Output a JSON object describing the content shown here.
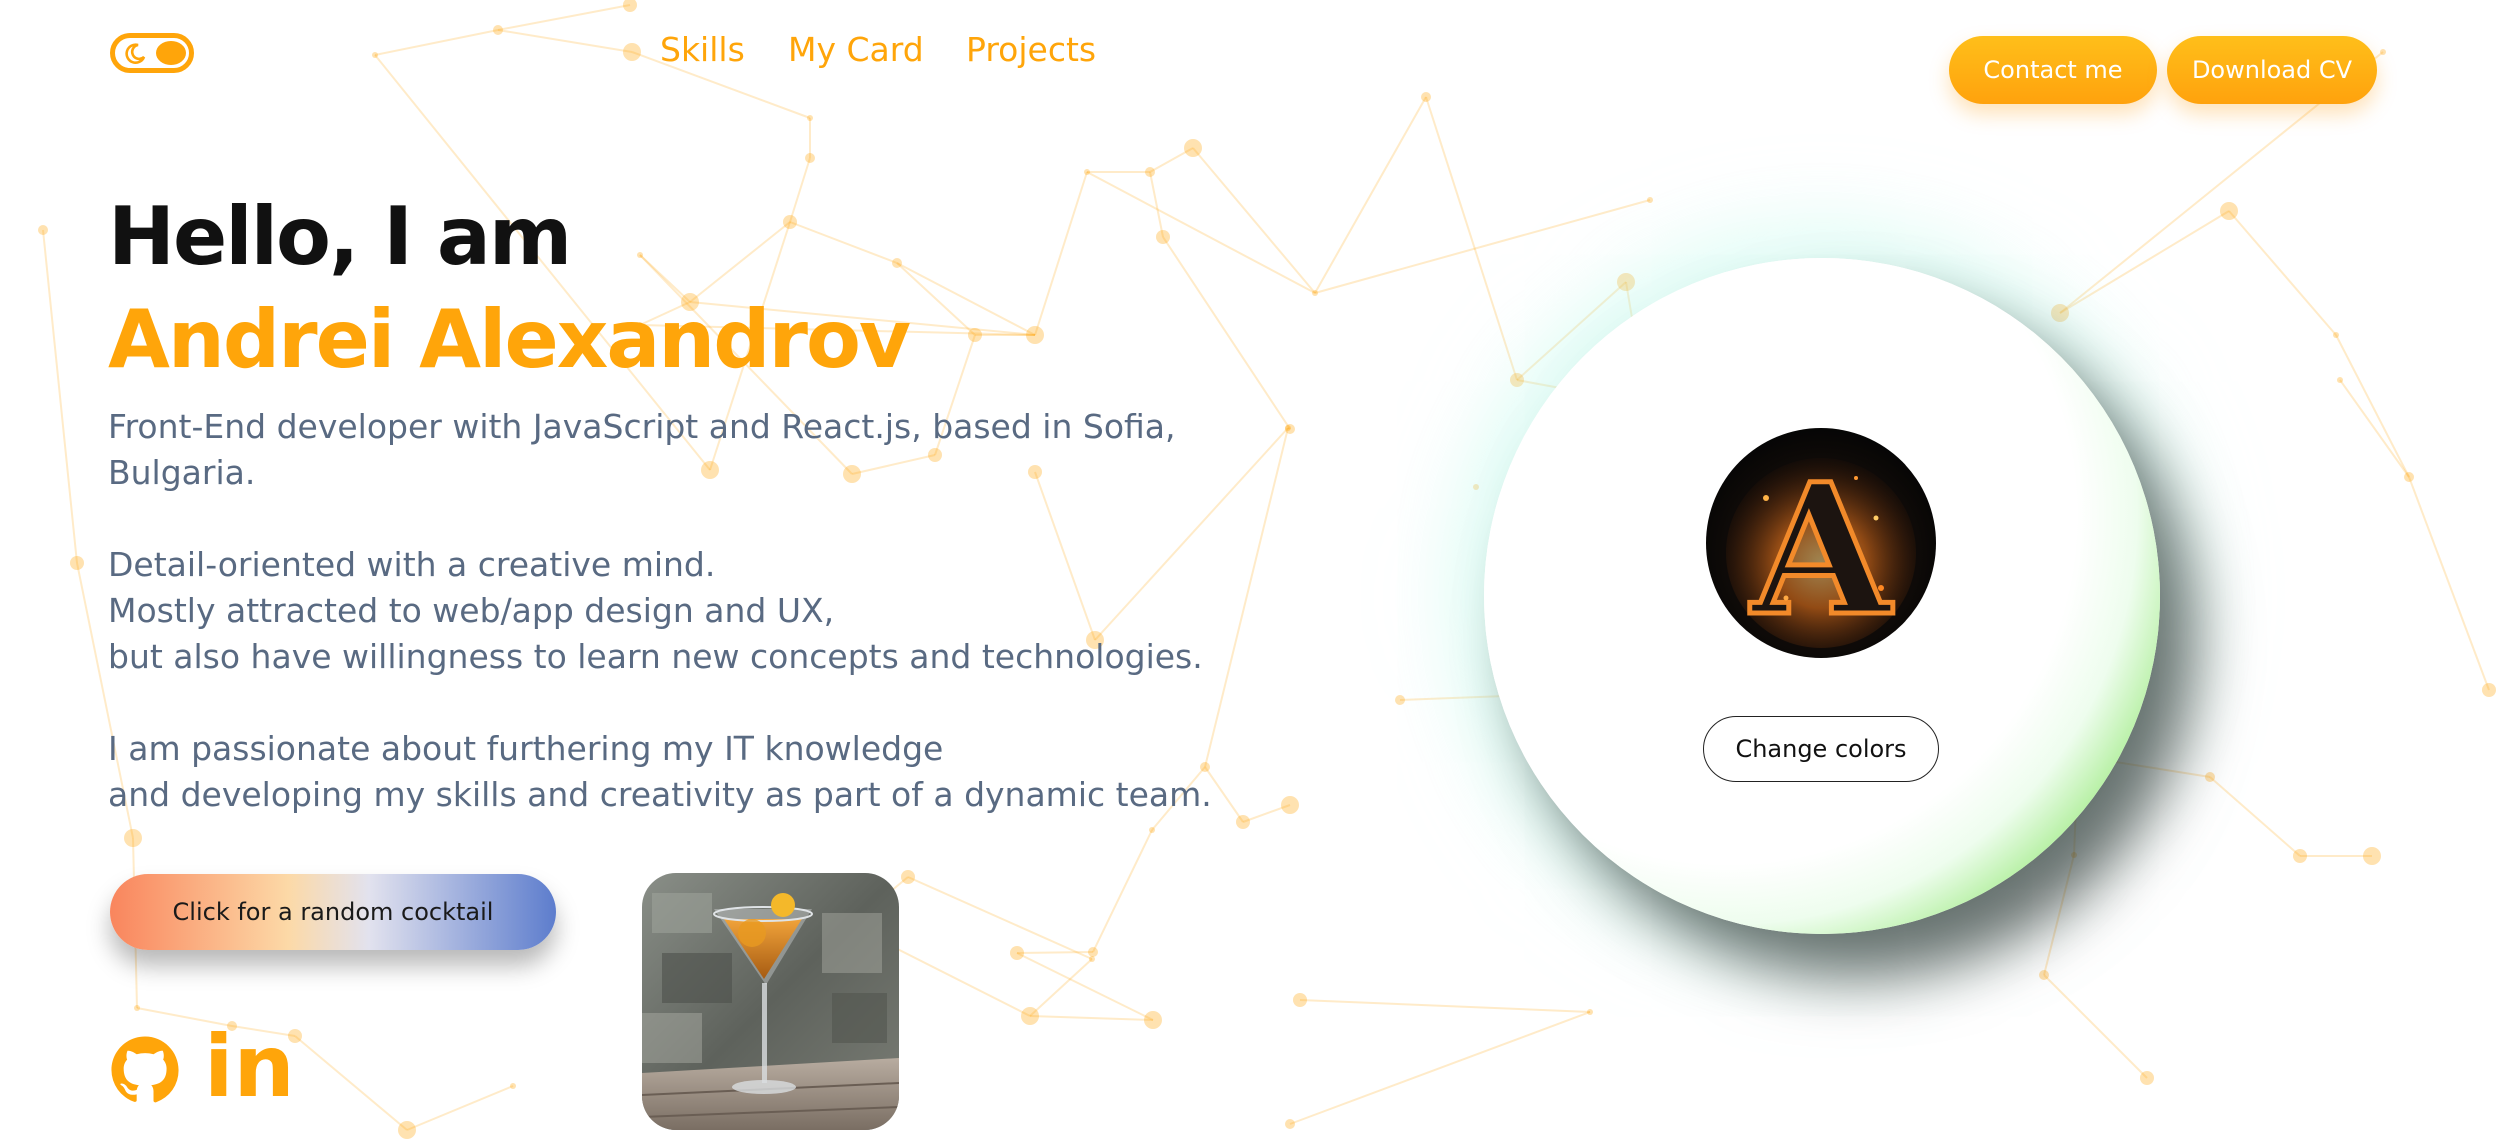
{
  "nav": {
    "links": [
      "Skills",
      "My Card",
      "Projects"
    ],
    "contact_label": "Contact me",
    "download_label": "Download CV"
  },
  "hero": {
    "greeting": "Hello, I am",
    "name": "Andrei Alexandrov",
    "bio_paragraphs": [
      [
        "Front-End developer with JavaScript and React.js, based in Sofia,",
        "Bulgaria."
      ],
      [
        "Detail-oriented with a creative mind.",
        "Mostly attracted to web/app design and UX,",
        "but also have willingness to learn new concepts and technologies."
      ],
      [
        "I am passionate about furthering my IT knowledge",
        "and developing my skills and creativity as part of a dynamic team."
      ]
    ],
    "cocktail_button_label": "Click for a random cocktail"
  },
  "card": {
    "avatar_letter": "A",
    "change_colors_label": "Change colors"
  },
  "social": {
    "icons": [
      "github-icon",
      "linkedin-icon"
    ],
    "linkedin_text": "in"
  },
  "colors": {
    "accent": "#ffa50a",
    "text_body": "#596a82",
    "card_ring": "#55d23c"
  }
}
